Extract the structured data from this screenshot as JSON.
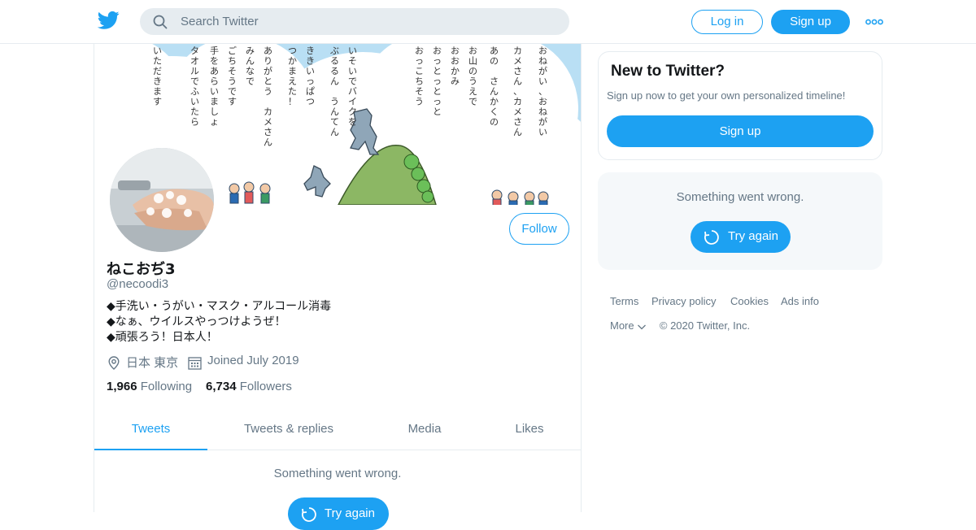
{
  "header": {
    "search_placeholder": "Search Twitter",
    "login_label": "Log in",
    "signup_label": "Sign up"
  },
  "banner": {
    "text_columns": [
      "おねがい、おねがい",
      "カメさん、カメさん",
      "あの　さんかくの",
      "お山のうえで",
      "おおかみ",
      "おっとっとっと",
      "おっこちそう",
      "いそいでバイクを",
      "ぶるるん　うんてん",
      "ききいっぱつ",
      "つかまえた！",
      "ありがとう　カメさん",
      "みんなで",
      "ごちそうです",
      "手をあらいましょ",
      "タオルでふいたら",
      "いただきます"
    ]
  },
  "profile": {
    "display_name": "ねこおぢ3",
    "handle": "@necoodi3",
    "follow_label": "Follow",
    "bio": [
      "◆手洗い・うがい・マスク・アルコール消毒",
      "◆なぁ、ウイルスやっつけようぜ！",
      "◆頑張ろう！日本人！"
    ],
    "location": "日本 東京",
    "joined": "Joined July 2019",
    "following_count": "1,966",
    "following_label": "Following",
    "followers_count": "6,734",
    "followers_label": "Followers"
  },
  "tabs": [
    {
      "label": "Tweets",
      "active": true
    },
    {
      "label": "Tweets & replies",
      "active": false
    },
    {
      "label": "Media",
      "active": false
    },
    {
      "label": "Likes",
      "active": false
    }
  ],
  "main_error": {
    "message": "Something went wrong.",
    "retry_label": "Try again"
  },
  "sidebar": {
    "new_title": "New to Twitter?",
    "new_subtitle": "Sign up now to get your own personalized timeline!",
    "new_signup_label": "Sign up",
    "error_message": "Something went wrong.",
    "retry_label": "Try again"
  },
  "footer": {
    "links": [
      "Terms",
      "Privacy policy",
      "Cookies",
      "Ads info"
    ],
    "more_label": "More",
    "copyright": "© 2020 Twitter, Inc."
  },
  "colors": {
    "accent": "#1da1f2",
    "muted": "#657786",
    "border": "#e6ecf0"
  }
}
